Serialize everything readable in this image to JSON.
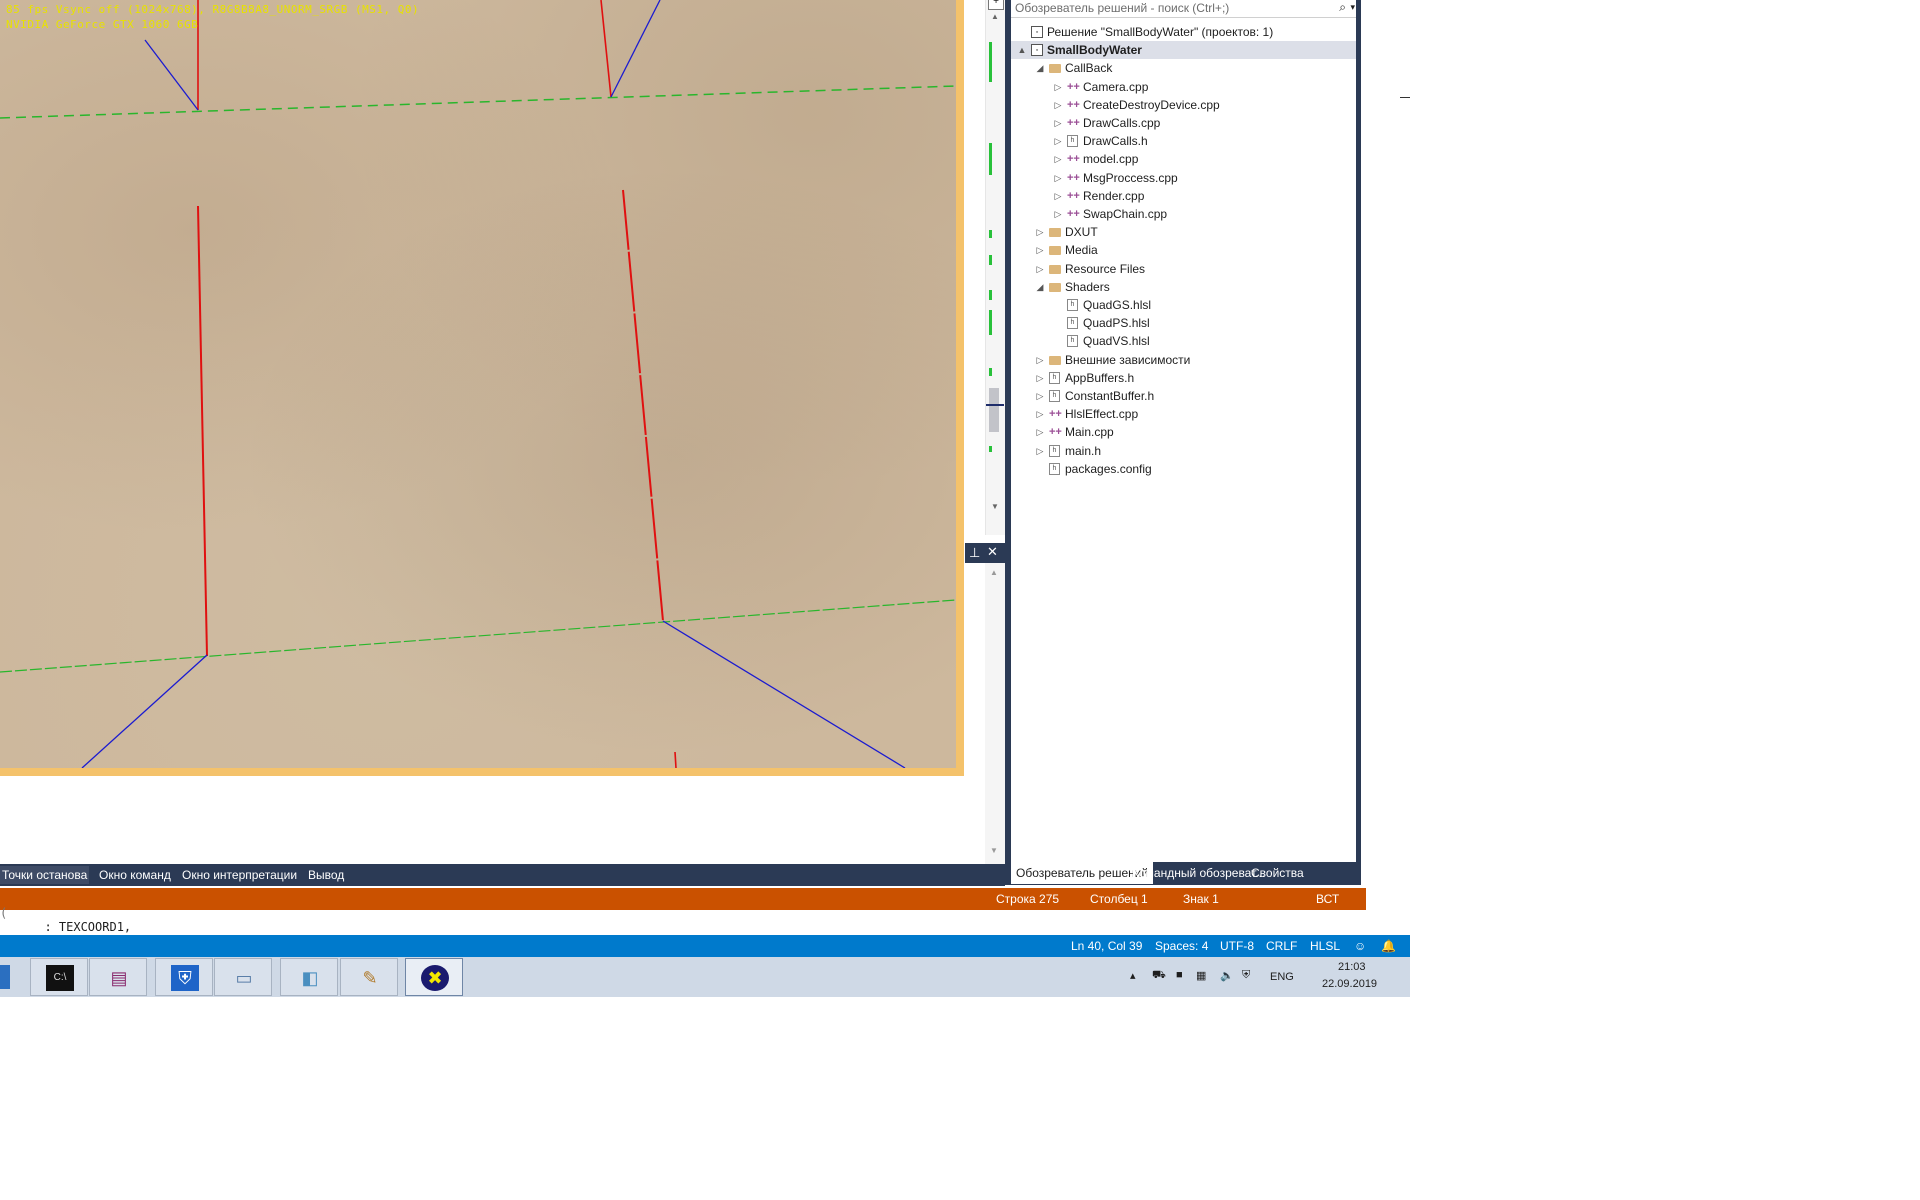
{
  "viewport": {
    "hud_line1": "85 fps Vsync off (1024x768), R8G8B8A8_UNORM_SRGB (MS1, Q0)",
    "hud_line2": "NVIDIA GeForce GTX 1060 6GB"
  },
  "solution_explorer": {
    "search_placeholder": "Обозреватель решений - поиск (Ctrl+;)",
    "tree": [
      {
        "label": "Решение \"SmallBodyWater\"  (проектов: 1)",
        "indent": 0,
        "twisty": "",
        "icon": "solution-icon",
        "kind": "sln"
      },
      {
        "label": "SmallBodyWater",
        "indent": 0,
        "twisty": "▲",
        "icon": "project-icon",
        "kind": "sln",
        "selected": true
      },
      {
        "label": "CallBack",
        "indent": 1,
        "twisty": "◢",
        "icon": "folder-icon",
        "kind": "folder"
      },
      {
        "label": "Camera.cpp",
        "indent": 2,
        "twisty": "▷",
        "icon": "cpp-file-icon",
        "kind": "cpp"
      },
      {
        "label": "CreateDestroyDevice.cpp",
        "indent": 2,
        "twisty": "▷",
        "icon": "cpp-file-icon",
        "kind": "cpp"
      },
      {
        "label": "DrawCalls.cpp",
        "indent": 2,
        "twisty": "▷",
        "icon": "cpp-file-icon",
        "kind": "cpp"
      },
      {
        "label": "DrawCalls.h",
        "indent": 2,
        "twisty": "▷",
        "icon": "header-file-icon",
        "kind": "h"
      },
      {
        "label": "model.cpp",
        "indent": 2,
        "twisty": "▷",
        "icon": "cpp-file-icon",
        "kind": "cpp"
      },
      {
        "label": "MsgProccess.cpp",
        "indent": 2,
        "twisty": "▷",
        "icon": "cpp-file-icon",
        "kind": "cpp"
      },
      {
        "label": "Render.cpp",
        "indent": 2,
        "twisty": "▷",
        "icon": "cpp-file-icon",
        "kind": "cpp"
      },
      {
        "label": "SwapChain.cpp",
        "indent": 2,
        "twisty": "▷",
        "icon": "cpp-file-icon",
        "kind": "cpp"
      },
      {
        "label": "DXUT",
        "indent": 1,
        "twisty": "▷",
        "icon": "folder-icon",
        "kind": "folder"
      },
      {
        "label": "Media",
        "indent": 1,
        "twisty": "▷",
        "icon": "folder-icon",
        "kind": "folder"
      },
      {
        "label": "Resource Files",
        "indent": 1,
        "twisty": "▷",
        "icon": "folder-icon",
        "kind": "folder"
      },
      {
        "label": "Shaders",
        "indent": 1,
        "twisty": "◢",
        "icon": "folder-icon",
        "kind": "folder"
      },
      {
        "label": "QuadGS.hlsl",
        "indent": 2,
        "twisty": "",
        "icon": "hlsl-file-icon",
        "kind": "h"
      },
      {
        "label": "QuadPS.hlsl",
        "indent": 2,
        "twisty": "",
        "icon": "hlsl-file-icon",
        "kind": "h"
      },
      {
        "label": "QuadVS.hlsl",
        "indent": 2,
        "twisty": "",
        "icon": "hlsl-file-icon",
        "kind": "h"
      },
      {
        "label": "Внешние зависимости",
        "indent": 1,
        "twisty": "▷",
        "icon": "dependencies-icon",
        "kind": "folder"
      },
      {
        "label": "AppBuffers.h",
        "indent": 1,
        "twisty": "▷",
        "icon": "header-file-icon",
        "kind": "h"
      },
      {
        "label": "ConstantBuffer.h",
        "indent": 1,
        "twisty": "▷",
        "icon": "header-file-icon",
        "kind": "h"
      },
      {
        "label": "HlslEffect.cpp",
        "indent": 1,
        "twisty": "▷",
        "icon": "cpp-file-icon",
        "kind": "cpp"
      },
      {
        "label": "Main.cpp",
        "indent": 1,
        "twisty": "▷",
        "icon": "cpp-file-icon",
        "kind": "cpp"
      },
      {
        "label": "main.h",
        "indent": 1,
        "twisty": "▷",
        "icon": "header-file-icon",
        "kind": "h"
      },
      {
        "label": "packages.config",
        "indent": 1,
        "twisty": "",
        "icon": "config-file-icon",
        "kind": "h"
      }
    ],
    "tabs": [
      "Обозреватель решений",
      "Командный обозреват...",
      "Свойства"
    ]
  },
  "bottom_tabs": [
    "Точки останова",
    "Окно команд",
    "Окно интерпретации",
    "Вывод"
  ],
  "vs_status": {
    "line": "Строка 275",
    "column": "Столбец 1",
    "char": "Знак 1",
    "mode": "ВСТ"
  },
  "code": {
    "text": "  : TEXCOORD1,"
  },
  "vscode_status": {
    "position": "Ln 40, Col 39",
    "spaces": "Spaces: 4",
    "encoding": "UTF-8",
    "eol": "CRLF",
    "language": "HLSL"
  },
  "taskbar": {
    "apps": [
      {
        "name": "cmd-icon",
        "glyph": "C:\\"
      },
      {
        "name": "winrar-icon",
        "glyph": "▤"
      },
      {
        "name": "defender-icon",
        "glyph": "⛨"
      },
      {
        "name": "scanner-icon",
        "glyph": "▭"
      },
      {
        "name": "notebook-icon",
        "glyph": "◧"
      },
      {
        "name": "paint-icon",
        "glyph": "✎"
      },
      {
        "name": "dxut-app-icon",
        "glyph": "✖"
      }
    ],
    "lang": "ENG",
    "time": "21:03",
    "date": "22.09.2019"
  },
  "colors": {
    "vs_status_bg": "#ca5100",
    "vscode_status_bg": "#007acc",
    "hud_text": "#e8e200",
    "viewport_border": "#f4c26b"
  }
}
